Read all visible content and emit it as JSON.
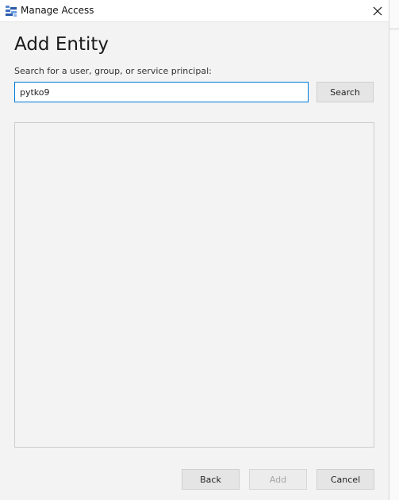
{
  "window": {
    "title": "Manage Access",
    "app_icon": "storage-explorer-icon",
    "close_icon": "close-icon",
    "close_glyph": "✕"
  },
  "main": {
    "heading": "Add Entity",
    "search_label": "Search for a user, group, or service principal:",
    "search_value": "pytko9",
    "search_button": "Search",
    "results": []
  },
  "footer": {
    "back_label": "Back",
    "add_label": "Add",
    "add_enabled": false,
    "cancel_label": "Cancel"
  },
  "colors": {
    "input_focus_border": "#0078d7",
    "background": "#f3f3f3"
  }
}
